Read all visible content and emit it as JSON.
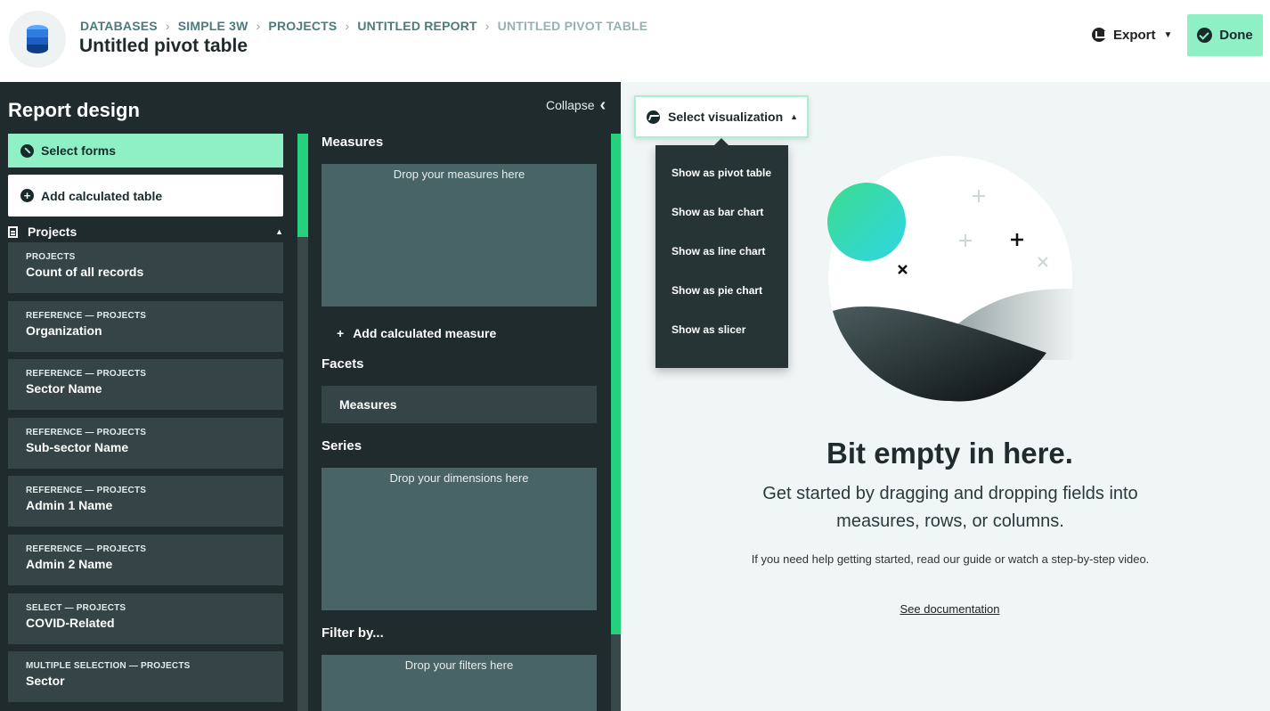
{
  "header": {
    "breadcrumbs": [
      "DATABASES",
      "SIMPLE 3W",
      "PROJECTS",
      "UNTITLED REPORT",
      "UNTITLED PIVOT TABLE"
    ],
    "title": "Untitled pivot table",
    "export_label": "Export",
    "done_label": "Done"
  },
  "left_panel": {
    "title": "Report design",
    "select_forms_label": "Select forms",
    "add_calc_table_label": "Add calculated table",
    "group_label": "Projects",
    "fields": [
      {
        "kind": "PROJECTS",
        "name": "Count of all records"
      },
      {
        "kind": "REFERENCE — PROJECTS",
        "name": "Organization"
      },
      {
        "kind": "REFERENCE — PROJECTS",
        "name": "Sector Name"
      },
      {
        "kind": "REFERENCE — PROJECTS",
        "name": "Sub-sector Name"
      },
      {
        "kind": "REFERENCE — PROJECTS",
        "name": "Admin 1 Name"
      },
      {
        "kind": "REFERENCE — PROJECTS",
        "name": "Admin 2 Name"
      },
      {
        "kind": "SELECT — PROJECTS",
        "name": "COVID-Related"
      },
      {
        "kind": "MULTIPLE SELECTION — PROJECTS",
        "name": "Sector"
      }
    ]
  },
  "mid_panel": {
    "collapse_label": "Collapse",
    "measures_label": "Measures",
    "measures_drop": "Drop your measures here",
    "add_measure_label": "Add calculated measure",
    "facets_label": "Facets",
    "facet_item": "Measures",
    "series_label": "Series",
    "series_drop": "Drop your dimensions here",
    "filter_label": "Filter by...",
    "filter_drop": "Drop your filters here"
  },
  "canvas": {
    "viz_button_label": "Select visualization",
    "viz_options": [
      "Show as pivot table",
      "Show as bar chart",
      "Show as line chart",
      "Show as pie chart",
      "Show as slicer"
    ],
    "empty_title": "Bit empty in here.",
    "empty_subtitle": "Get started by dragging and dropping fields into measures, rows, or columns.",
    "empty_help": "If you need help getting started, read our guide or watch a step-by-step video.",
    "doc_link": "See documentation"
  },
  "colors": {
    "accent": "#26d07c",
    "accent_light": "#8ff0c5",
    "panel_bg": "#1f2b2d",
    "dropzone": "#486466"
  }
}
